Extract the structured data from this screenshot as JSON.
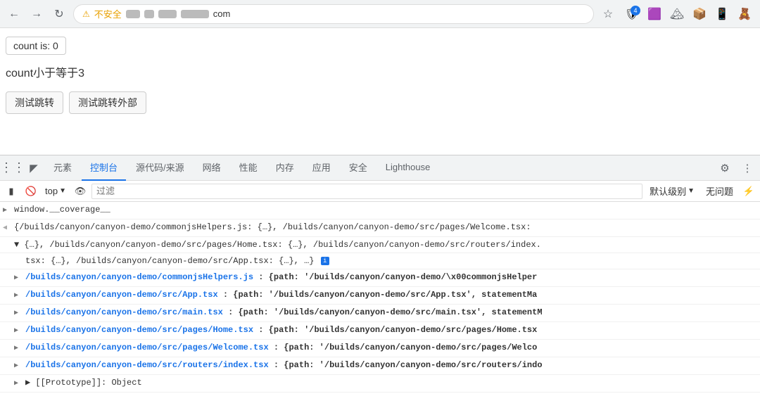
{
  "browser": {
    "back_label": "←",
    "forward_label": "→",
    "reload_label": "↻",
    "security_label": "⚠",
    "security_text": "不安全",
    "url_com": "com",
    "star_icon": "☆",
    "toolbar_icons": [
      "🛡",
      "🟣",
      "🏔",
      "📦",
      "📱",
      "🧸"
    ]
  },
  "page": {
    "count_badge": "count is: 0",
    "count_desc": "count小于等于3",
    "btn_jump": "测试跳转",
    "btn_jump_external": "测试跳转外部"
  },
  "devtools": {
    "tabs": [
      {
        "label": "元素",
        "active": false
      },
      {
        "label": "控制台",
        "active": true
      },
      {
        "label": "源代码/来源",
        "active": false
      },
      {
        "label": "网络",
        "active": false
      },
      {
        "label": "性能",
        "active": false
      },
      {
        "label": "内存",
        "active": false
      },
      {
        "label": "应用",
        "active": false
      },
      {
        "label": "安全",
        "active": false
      },
      {
        "label": "Lighthouse",
        "active": false
      }
    ],
    "filter_placeholder": "过滤",
    "level_select": "默认级别",
    "no_issues": "无问题",
    "top_label": "top"
  },
  "console": {
    "line1_text": "window.__coverage__",
    "line2_text": "{/builds/canyon/canyon-demo/commonjsHelpers.js: {…}, /builds/canyon/canyon-demo/src/pages/Welcome.tsx:",
    "line3_text": "▼ {…}, /builds/canyon/canyon-demo/src/pages/Home.tsx: {…}, /builds/canyon/canyon-demo/src/routers/index.",
    "line3b_text": "tsx: {…}, /builds/canyon/canyon-demo/src/App.tsx: {…}, …}",
    "line4_link": "/builds/canyon/canyon-demo/commonjsHelpers.js",
    "line4_val": ": {path: '/builds/canyon/canyon-demo/\\x00commonjsHelper",
    "line5_link": "/builds/canyon/canyon-demo/src/App.tsx",
    "line5_val": ": {path: '/builds/canyon/canyon-demo/src/App.tsx', statementMa",
    "line6_link": "/builds/canyon/canyon-demo/src/main.tsx",
    "line6_val": ": {path: '/builds/canyon/canyon-demo/src/main.tsx', statementM",
    "line7_link": "/builds/canyon/canyon-demo/src/pages/Home.tsx",
    "line7_val": ": {path: '/builds/canyon/canyon-demo/src/pages/Home.tsx",
    "line8_link": "/builds/canyon/canyon-demo/src/pages/Welcome.tsx",
    "line8_val": ": {path: '/builds/canyon/canyon-demo/src/pages/Welco",
    "line9_link": "/builds/canyon/canyon-demo/src/routers/index.tsx",
    "line9_val": ": {path: '/builds/canyon/canyon-demo/src/routers/indo",
    "line10_text": "▶ [[Prototype]]: Object"
  }
}
